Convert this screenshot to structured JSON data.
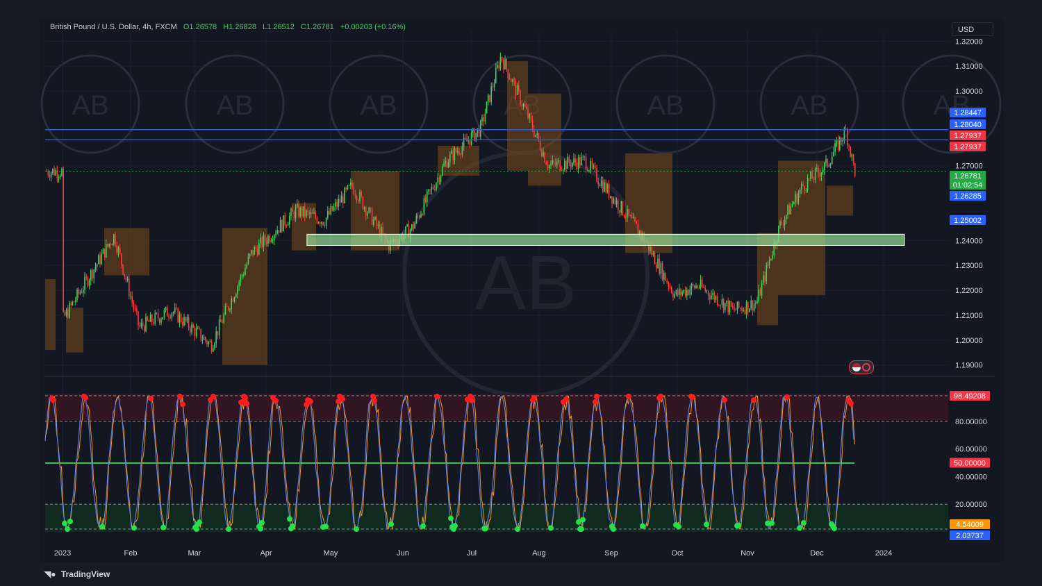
{
  "header": {
    "symbol": "British Pound / U.S. Dollar, 4h, FXCM",
    "open": "O1.26578",
    "high": "H1.26828",
    "low": "L1.26512",
    "close": "C1.26781",
    "change": "+0.00203 (+0.16%)"
  },
  "currency_label": "USD",
  "branding": "TradingView",
  "watermark_text": "AB",
  "colors": {
    "up": "#26a69a",
    "down": "#ef5350",
    "upCandle": "#3fd35a",
    "downCandle": "#ff3b3b",
    "blueLine": "#2f5bd6",
    "zone": "#8fd18f",
    "orange": "#ff9800",
    "bg": "#131722"
  },
  "chart_data": [
    {
      "type": "candlestick",
      "title": "British Pound / U.S. Dollar, 4h, FXCM",
      "x_ticks": [
        "2023",
        "Feb",
        "Mar",
        "Apr",
        "May",
        "Jun",
        "Jul",
        "Aug",
        "Sep",
        "Oct",
        "Nov",
        "Dec",
        "2024"
      ],
      "y_ticks": [
        "1.32000",
        "1.31000",
        "1.30000",
        "1.27000",
        "1.24000",
        "1.23000",
        "1.22000",
        "1.21000",
        "1.20000",
        "1.19000"
      ],
      "ylim": [
        1.186,
        1.324
      ],
      "approx_close_path": {
        "x": [
          "2023",
          "Jan-10",
          "Jan-25",
          "Feb-05",
          "Feb-20",
          "Mar-08",
          "Mar-25",
          "Apr-15",
          "Apr-28",
          "May-10",
          "May-25",
          "Jun-05",
          "Jun-20",
          "Jul-05",
          "Jul-14",
          "Jul-25",
          "Aug-05",
          "Aug-20",
          "Sep-01",
          "Sep-15",
          "Sep-30",
          "Oct-10",
          "Oct-25",
          "Nov-05",
          "Nov-15",
          "Nov-25",
          "Dec-05",
          "Dec-14",
          "Dec-18"
        ],
        "y": [
          1.208,
          1.215,
          1.242,
          1.205,
          1.212,
          1.198,
          1.235,
          1.252,
          1.248,
          1.262,
          1.238,
          1.245,
          1.272,
          1.285,
          1.314,
          1.292,
          1.27,
          1.272,
          1.258,
          1.242,
          1.218,
          1.222,
          1.212,
          1.215,
          1.246,
          1.262,
          1.27,
          1.284,
          1.2678
        ]
      },
      "horizontal_lines": [
        1.28447,
        1.2804
      ],
      "zone": {
        "from": "Apr-20",
        "to": "Dec-31",
        "high": 1.2425,
        "low": 1.238
      },
      "price_labels": [
        {
          "value": "1.28447",
          "color": "#2962ff"
        },
        {
          "value": "1.28040",
          "color": "#2962ff"
        },
        {
          "value": "1.27937",
          "color": "#f23645"
        },
        {
          "value": "1.27937",
          "color": "#f23645"
        },
        {
          "value": "1.26781",
          "color": "#22ab44"
        },
        {
          "value": "01:02:54",
          "color": "#22ab44"
        },
        {
          "value": "1.26285",
          "color": "#2962ff"
        },
        {
          "value": "1.25002",
          "color": "#2962ff"
        }
      ]
    },
    {
      "type": "line",
      "title": "",
      "y_ticks": [
        "80.00000",
        "60.00000",
        "40.00000",
        "20.00000"
      ],
      "ylim": [
        0,
        100
      ],
      "bands": {
        "overbought": 80,
        "oversold": 20,
        "mid": 50
      },
      "oscillation": "stochastic-like, swinging between ~2 and ~98 roughly every 2-4 days",
      "price_labels": [
        {
          "value": "98.49208",
          "color": "#f23645"
        },
        {
          "value": "50.00000",
          "color": "#f23645"
        },
        {
          "value": "4.54009",
          "color": "#ff9800"
        },
        {
          "value": "2.03737",
          "color": "#2962ff"
        }
      ]
    }
  ]
}
